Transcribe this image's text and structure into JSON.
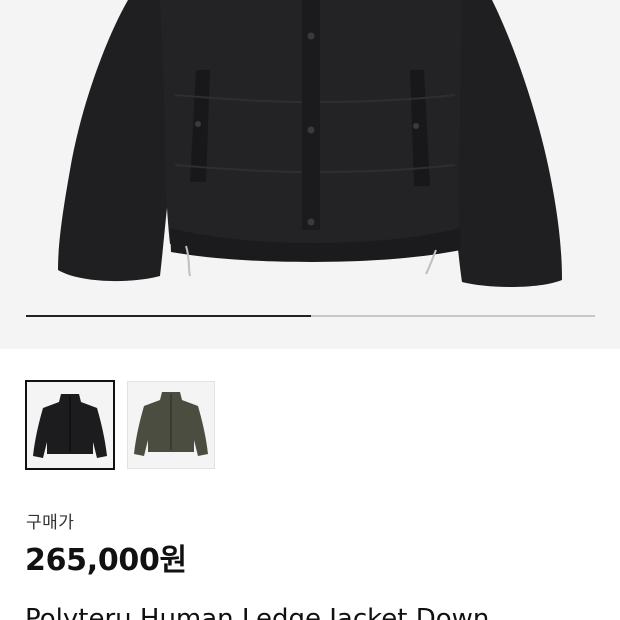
{
  "hero": {
    "image": "black-puffer-jacket-image",
    "progress": 0.5
  },
  "thumbnails": [
    {
      "name": "black-jacket-thumbnail",
      "color": "#1c1c1e",
      "selected": true
    },
    {
      "name": "khaki-jacket-thumbnail",
      "color": "#4a4d3f",
      "selected": false
    }
  ],
  "price": {
    "label": "구매가",
    "value": "265,000원"
  },
  "product": {
    "name": "Polyteru Human Ledge Jacket Down"
  },
  "colors": {
    "hero_background": "#f4f4f4",
    "progress_active": "#222222",
    "progress_track": "#c6c6c6"
  }
}
